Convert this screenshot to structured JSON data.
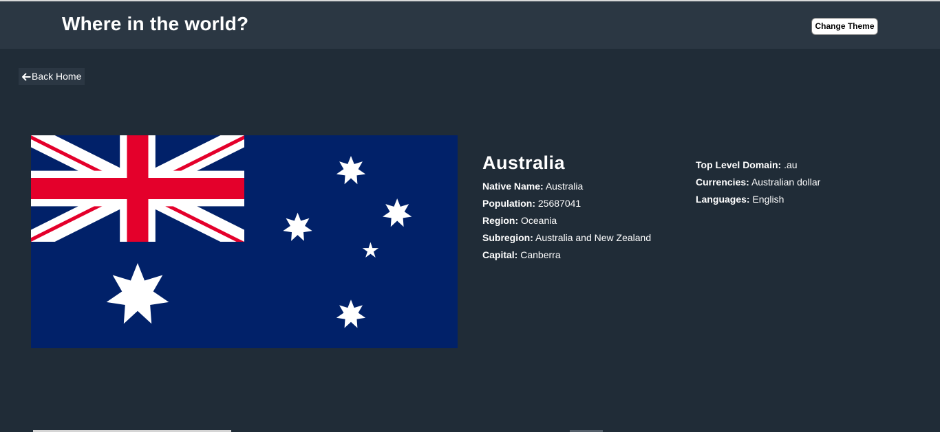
{
  "header": {
    "title": "Where in the world?",
    "theme_button": "Change Theme"
  },
  "back_button": {
    "label": "Back Home",
    "icon": "arrow-left-icon"
  },
  "country": {
    "flag_icon": "australia-flag-image",
    "name": "Australia",
    "details_left": [
      {
        "label": "Native Name:",
        "value": "Australia"
      },
      {
        "label": "Population:",
        "value": "25687041"
      },
      {
        "label": "Region:",
        "value": "Oceania"
      },
      {
        "label": "Subregion:",
        "value": "Australia and New Zealand"
      },
      {
        "label": "Capital:",
        "value": "Canberra"
      }
    ],
    "details_right": [
      {
        "label": "Top Level Domain:",
        "value": ".au"
      },
      {
        "label": "Currencies:",
        "value": "Australian dollar"
      },
      {
        "label": "Languages:",
        "value": "English"
      }
    ]
  },
  "colors": {
    "background": "#202c37",
    "header": "#2b3743",
    "text": "#ffffff",
    "flag_blue": "#012169",
    "flag_red": "#e4002b"
  }
}
